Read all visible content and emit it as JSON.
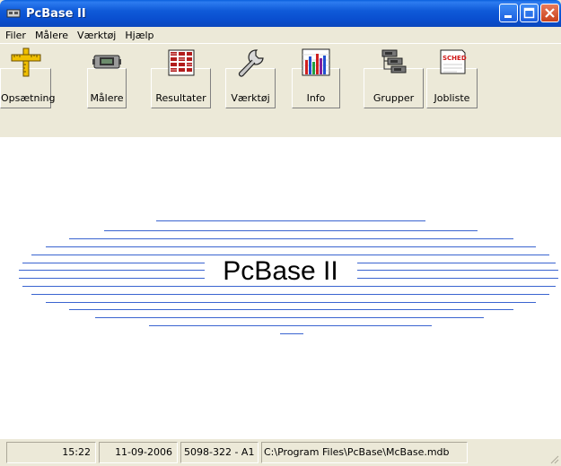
{
  "window": {
    "title": "PcBase II"
  },
  "menu": [
    "Filer",
    "Målere",
    "Værktøj",
    "Hjælp"
  ],
  "toolbar": [
    {
      "label": "Opsætning",
      "icon": "ruler-icon"
    },
    {
      "label": "Målere",
      "icon": "meter-device-icon"
    },
    {
      "label": "Resultater",
      "icon": "results-grid-icon"
    },
    {
      "label": "Værktøj",
      "icon": "wrench-icon"
    },
    {
      "label": "Info",
      "icon": "bar-chart-icon"
    },
    {
      "label": "Grupper",
      "icon": "groups-icon"
    },
    {
      "label": "Jobliste",
      "icon": "schedule-icon"
    }
  ],
  "icon_texts": {
    "schedule": "SCHED"
  },
  "splash": {
    "title": "PcBase II"
  },
  "status": {
    "time": "15:22",
    "date": "11-09-2006",
    "version": "5098-322 - A1",
    "path": "C:\\Program Files\\PcBase\\McBase.mdb"
  },
  "colors": {
    "titlebar": "#0a4fd0",
    "splash_lines": "#3a64d0"
  }
}
